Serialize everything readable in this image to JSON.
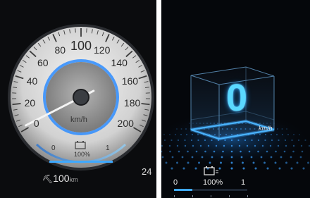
{
  "left_cluster": {
    "speed_ticks": [
      "0",
      "20",
      "40",
      "60",
      "80",
      "100",
      "120",
      "140",
      "160",
      "180",
      "200"
    ],
    "speed_unit": "km/h",
    "needle_speed": 0,
    "battery": {
      "min_label": "0",
      "max_label": "1",
      "percent_text": "100%",
      "fill_fraction": 1.0,
      "icon": "battery-icon"
    },
    "range": {
      "value": "100",
      "unit": "km",
      "icon": "plug-icon"
    },
    "partial_right_value": "24"
  },
  "right_cluster": {
    "speed_value": "0",
    "speed_unit": "km/h",
    "battery": {
      "min_label": "0",
      "max_label": "1",
      "percent_text": "100%",
      "fill_fraction": 0.25,
      "icon": "battery-icon"
    }
  },
  "colors": {
    "accent_blue": "#3fa9ff",
    "cyan_digit": "#5ad8ff",
    "background_dark": "#0b0c0e"
  }
}
